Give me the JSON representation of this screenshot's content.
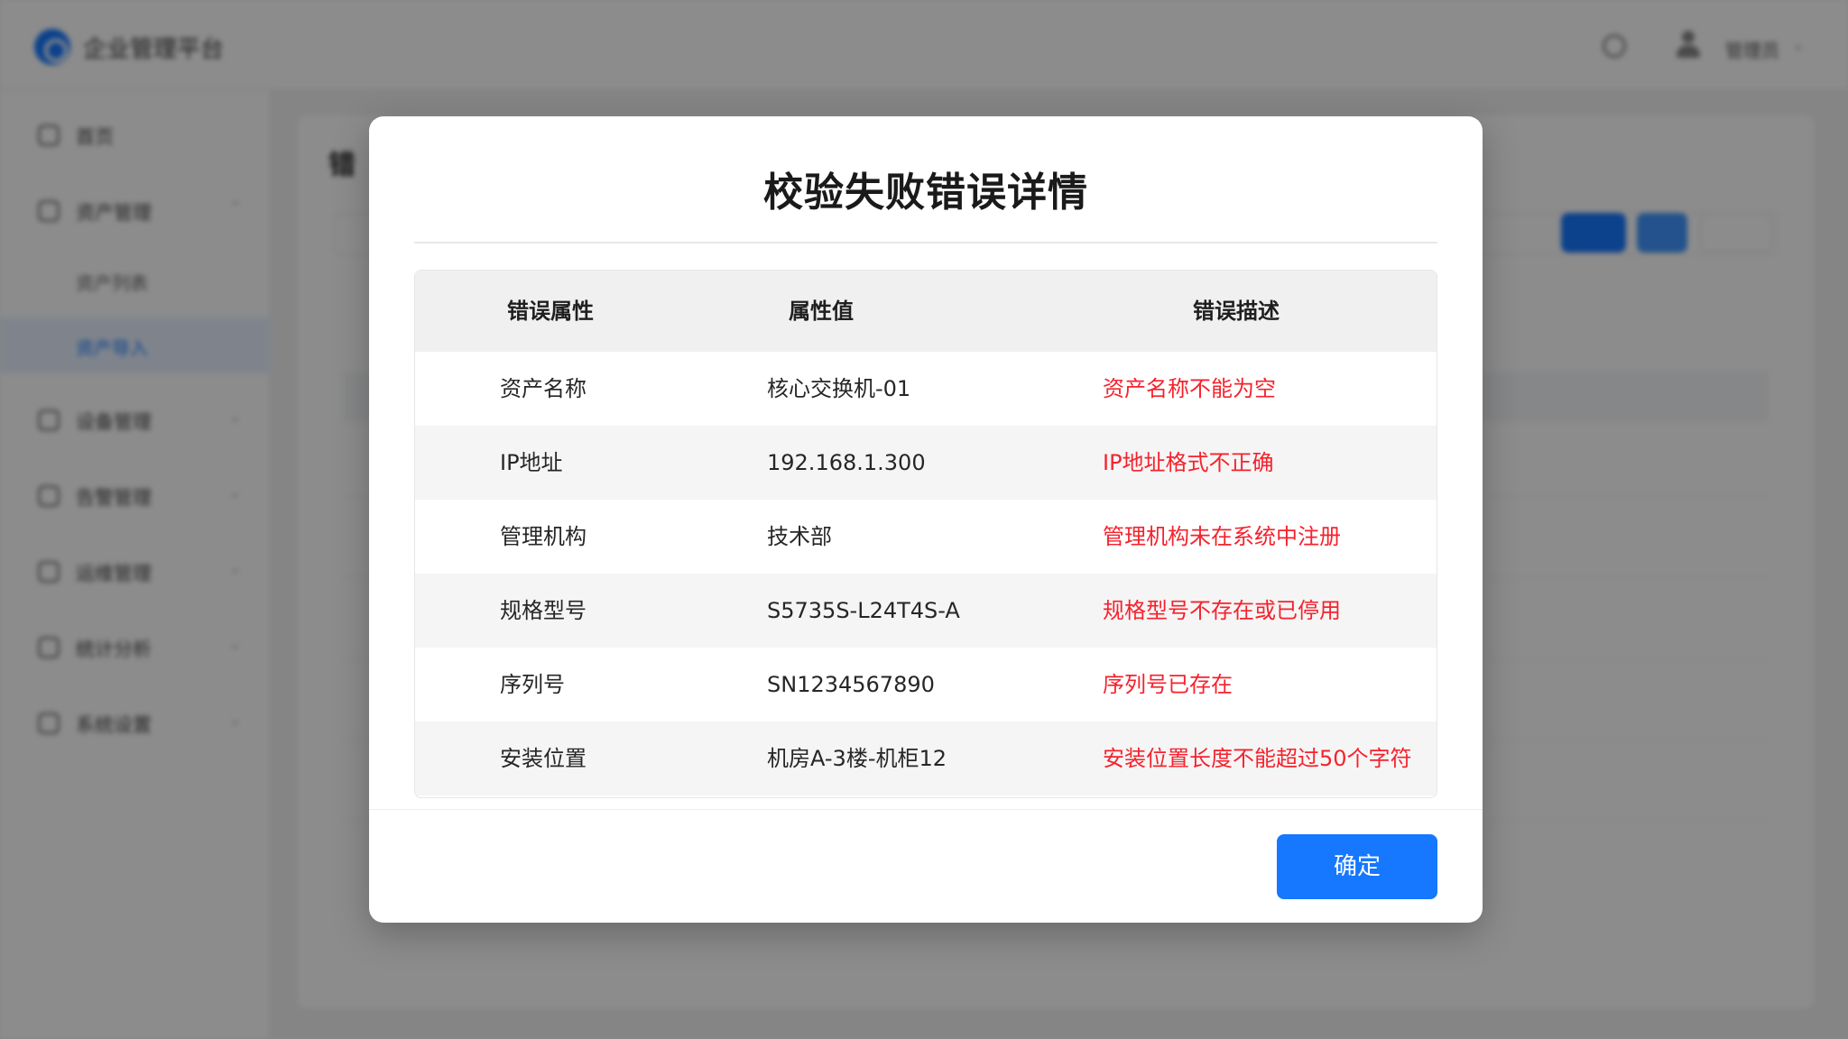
{
  "background": {
    "app_title": "企业管理平台",
    "user_name": "管理员",
    "sidebar": {
      "items": [
        {
          "label": "首页"
        },
        {
          "label": "资产管理"
        },
        {
          "label": "设备管理"
        },
        {
          "label": "告警管理"
        },
        {
          "label": "运维管理"
        },
        {
          "label": "统计分析"
        },
        {
          "label": "系统设置"
        }
      ],
      "sub_items": [
        {
          "label": "资产列表"
        },
        {
          "label": "资产导入"
        }
      ]
    },
    "page_title": "错"
  },
  "modal": {
    "title": "校验失败错误详情",
    "columns": [
      "错误属性",
      "属性值",
      "错误描述"
    ],
    "rows": [
      {
        "attribute": "资产名称",
        "value": "核心交换机-01",
        "error": "资产名称不能为空"
      },
      {
        "attribute": "IP地址",
        "value": "192.168.1.300",
        "error": "IP地址格式不正确"
      },
      {
        "attribute": "管理机构",
        "value": "技术部",
        "error": "管理机构未在系统中注册"
      },
      {
        "attribute": "规格型号",
        "value": "S5735S-L24T4S-A",
        "error": "规格型号不存在或已停用"
      },
      {
        "attribute": "序列号",
        "value": "SN1234567890",
        "error": "序列号已存在"
      },
      {
        "attribute": "安装位置",
        "value": "机房A-3楼-机柜12",
        "error": "安装位置长度不能超过50个字符"
      }
    ],
    "confirm_label": "确定"
  },
  "colors": {
    "primary": "#1677ff",
    "error_text": "#f5222d"
  }
}
